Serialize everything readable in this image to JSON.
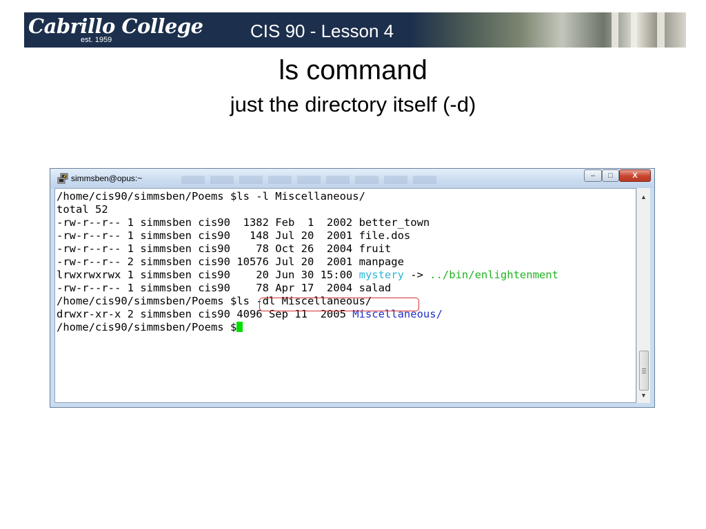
{
  "banner": {
    "logo_text": "Cabrillo College",
    "logo_est": "est. 1959",
    "title": "CIS 90 - Lesson 4"
  },
  "slide": {
    "title": "ls command",
    "subtitle": "just the directory itself (-d)"
  },
  "window": {
    "title": "simmsben@opus:~",
    "controls": {
      "minimize": "–",
      "maximize": "□",
      "close": "X"
    },
    "app_icon": "putty-terminal-icon"
  },
  "terminal": {
    "lines": [
      {
        "text": "/home/cis90/simmsben/Poems $ls -l Miscellaneous/"
      },
      {
        "text": "total 52"
      },
      {
        "text": "-rw-r--r-- 1 simmsben cis90  1382 Feb  1  2002 better_town"
      },
      {
        "text": "-rw-r--r-- 1 simmsben cis90   148 Jul 20  2001 file.dos"
      },
      {
        "text": "-rw-r--r-- 1 simmsben cis90    78 Oct 26  2004 fruit"
      },
      {
        "text": "-rw-r--r-- 2 simmsben cis90 10576 Jul 20  2001 manpage"
      },
      {
        "prefix": "lrwxrwxrwx 1 simmsben cis90    20 Jun 30 15:00 ",
        "link_name": "mystery",
        "arrow": " -> ",
        "link_target": "../bin/enlightenment"
      },
      {
        "text": "-rw-r--r-- 1 simmsben cis90    78 Apr 17  2004 salad"
      },
      {
        "prompt": "/home/cis90/simmsben/Poems $",
        "command": "ls -dl Miscellaneous/"
      },
      {
        "prefix": "drwxr-xr-x 2 simmsben cis90 4096 Sep 11  2005 ",
        "dir_name": "Miscellaneous/"
      },
      {
        "prompt": "/home/cis90/simmsben/Poems $"
      }
    ]
  },
  "colors": {
    "banner_bg": "#1c2f4c",
    "symlink": "#2cb6d6",
    "symlink_target": "#1eb31e",
    "directory": "#1d2fc4",
    "cursor": "#00e000",
    "highlight_box": "#d22d2d"
  }
}
